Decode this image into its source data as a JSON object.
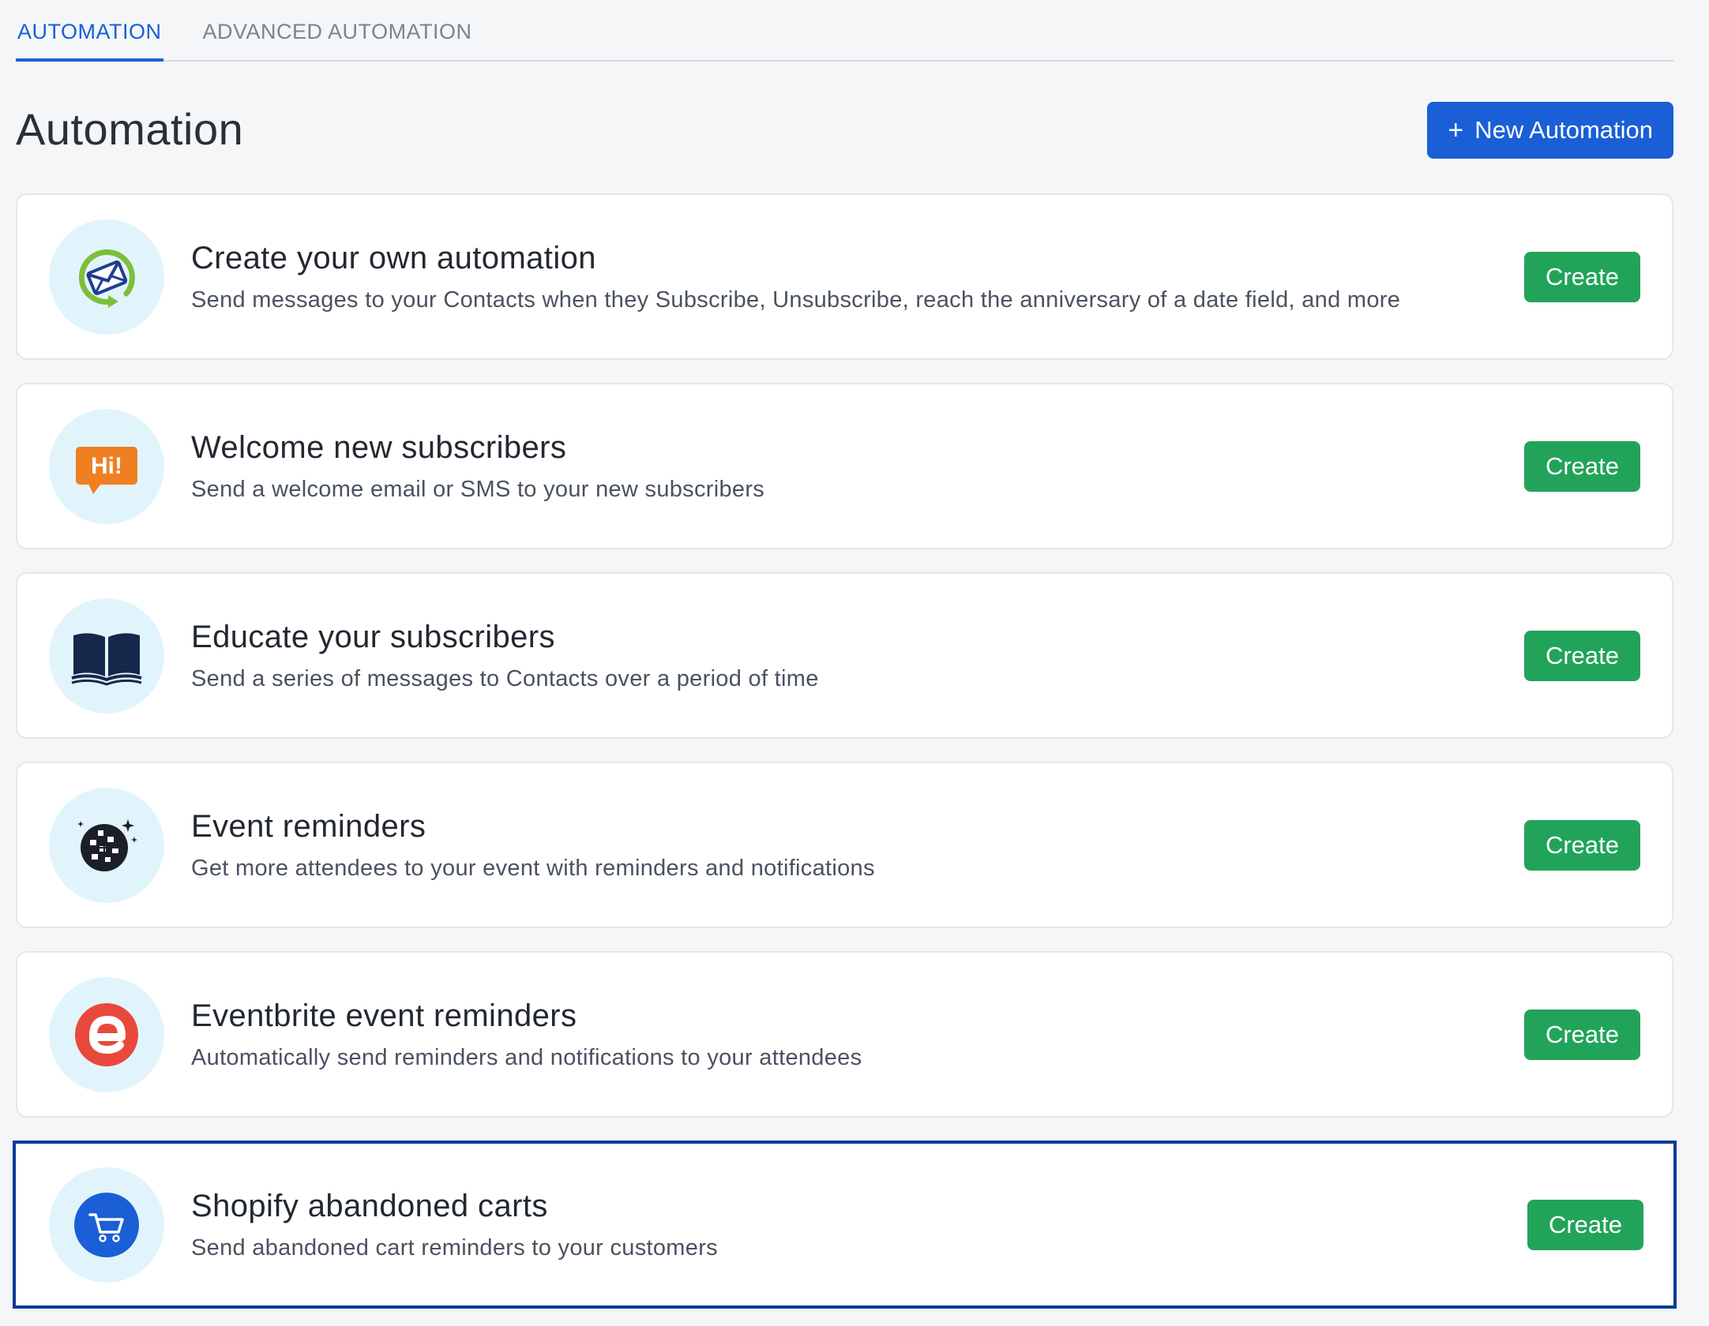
{
  "tabs": [
    {
      "label": "AUTOMATION",
      "active": true
    },
    {
      "label": "ADVANCED AUTOMATION",
      "active": false
    }
  ],
  "header": {
    "title": "Automation",
    "new_button": {
      "icon": "plus-icon",
      "label": "New Automation"
    }
  },
  "colors": {
    "primary": "#1a5fd6",
    "create": "#22a35a",
    "icon_bg": "#e2f4fb",
    "selected_border": "#0b3a96"
  },
  "automations": [
    {
      "title": "Create your own automation",
      "description": "Send messages to your Contacts when they Subscribe, Unsubscribe, reach the anniversary of a date field, and more",
      "icon": "envelope-cycle-icon",
      "button": "Create"
    },
    {
      "title": "Welcome new subscribers",
      "description": "Send a welcome email or SMS to your new subscribers",
      "icon": "hi-speech-bubble-icon",
      "icon_text": "Hi!",
      "button": "Create"
    },
    {
      "title": "Educate your subscribers",
      "description": "Send a series of messages to Contacts over a period of time",
      "icon": "open-book-icon",
      "button": "Create"
    },
    {
      "title": "Event reminders",
      "description": "Get more attendees to your event with reminders and notifications",
      "icon": "disco-ball-icon",
      "button": "Create"
    },
    {
      "title": "Eventbrite event reminders",
      "description": "Automatically send reminders and notifications to your attendees",
      "icon": "eventbrite-logo-icon",
      "button": "Create"
    },
    {
      "title": "Shopify abandoned carts",
      "description": "Send abandoned cart reminders to your customers",
      "icon": "shopping-cart-icon",
      "button": "Create",
      "selected": true
    }
  ]
}
